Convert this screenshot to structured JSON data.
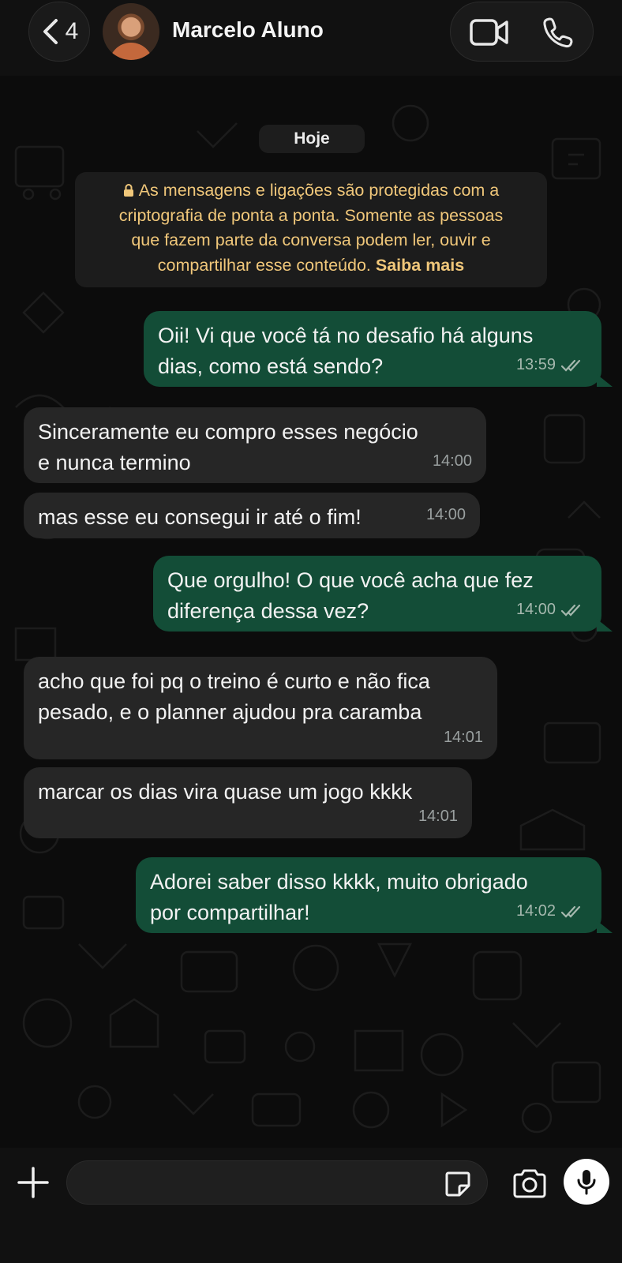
{
  "header": {
    "back_count": "4",
    "contact_name": "Marcelo Aluno",
    "icons": [
      "chevron-left-icon",
      "video-call-icon",
      "phone-icon"
    ]
  },
  "chat": {
    "date_label": "Hoje",
    "encryption_notice": {
      "line1": "As mensagens e ligações são protegidas com a",
      "line2": "criptografia de ponta a ponta. Somente as pessoas",
      "line3": "que fazem parte da conversa podem ler, ouvir e",
      "line4": "compartilhar esse conteúdo.",
      "link": "Saiba mais"
    },
    "messages": [
      {
        "direction": "out",
        "lines": [
          "Oii! Vi que você tá no desafio há alguns",
          "dias, como está sendo?"
        ],
        "time": "13:59",
        "read": true
      },
      {
        "direction": "in",
        "lines": [
          "Sinceramente eu compro esses negócio",
          "e nunca termino"
        ],
        "time": "14:00"
      },
      {
        "direction": "in",
        "lines": [
          "mas esse eu consegui ir até o fim!"
        ],
        "time": "14:00"
      },
      {
        "direction": "out",
        "lines": [
          "Que orgulho! O que você acha que fez",
          "diferença dessa vez?"
        ],
        "time": "14:00",
        "read": true
      },
      {
        "direction": "in",
        "lines": [
          "acho que foi pq o treino é curto e não fica",
          "pesado, e o planner ajudou pra caramba"
        ],
        "time": "14:01"
      },
      {
        "direction": "in",
        "lines": [
          "marcar os dias vira quase um jogo kkkk"
        ],
        "time": "14:01"
      },
      {
        "direction": "out",
        "lines": [
          "Adorei saber disso kkkk, muito obrigado",
          "por compartilhar!"
        ],
        "time": "14:02",
        "read": true
      }
    ]
  },
  "composer": {
    "input_value": "",
    "icons": [
      "plus-icon",
      "sticker-icon",
      "camera-icon",
      "microphone-icon"
    ]
  },
  "colors": {
    "outgoing_bubble": "#134d37",
    "incoming_bubble": "#262626",
    "notice_text": "#f0c77a",
    "background": "#0c0c0c"
  }
}
